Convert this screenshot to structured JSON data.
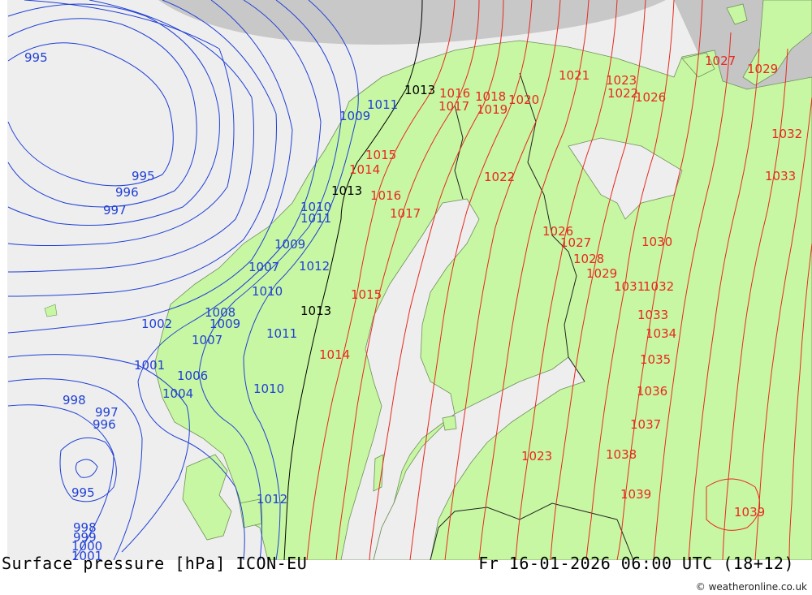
{
  "footer": {
    "left": "Surface pressure [hPa] ICON-EU",
    "right": "Fr 16-01-2026 06:00 UTC (18+12)",
    "credit": "© weatheronline.co.uk"
  },
  "colors": {
    "sea": "#eeeeee",
    "land": "#c8f7a3",
    "low_isobar": "#1f3fd6",
    "mid_isobar": "#000000",
    "high_isobar": "#e8281e",
    "no_data": "#c8c8c8"
  },
  "isobar_labels": [
    {
      "text": "995",
      "color": "blue"
    },
    {
      "text": "995",
      "color": "blue"
    },
    {
      "text": "996",
      "color": "blue"
    },
    {
      "text": "997",
      "color": "blue"
    },
    {
      "text": "998",
      "color": "blue"
    },
    {
      "text": "997",
      "color": "blue"
    },
    {
      "text": "996",
      "color": "blue"
    },
    {
      "text": "995",
      "color": "blue"
    },
    {
      "text": "998",
      "color": "blue"
    },
    {
      "text": "999",
      "color": "blue"
    },
    {
      "text": "1000",
      "color": "blue"
    },
    {
      "text": "1001",
      "color": "blue"
    },
    {
      "text": "1001",
      "color": "blue"
    },
    {
      "text": "1002",
      "color": "blue"
    },
    {
      "text": "1004",
      "color": "blue"
    },
    {
      "text": "1006",
      "color": "blue"
    },
    {
      "text": "1007",
      "color": "blue"
    },
    {
      "text": "1008",
      "color": "blue"
    },
    {
      "text": "1009",
      "color": "blue"
    },
    {
      "text": "1009",
      "color": "blue"
    },
    {
      "text": "1009",
      "color": "blue"
    },
    {
      "text": "1007",
      "color": "blue"
    },
    {
      "text": "1010",
      "color": "blue"
    },
    {
      "text": "1010",
      "color": "blue"
    },
    {
      "text": "1010",
      "color": "blue"
    },
    {
      "text": "1011",
      "color": "blue"
    },
    {
      "text": "1011",
      "color": "blue"
    },
    {
      "text": "1011",
      "color": "blue"
    },
    {
      "text": "1012",
      "color": "blue"
    },
    {
      "text": "1012",
      "color": "blue"
    },
    {
      "text": "1013",
      "color": "black"
    },
    {
      "text": "1013",
      "color": "black"
    },
    {
      "text": "1013",
      "color": "black"
    },
    {
      "text": "1014",
      "color": "red"
    },
    {
      "text": "1014",
      "color": "red"
    },
    {
      "text": "1015",
      "color": "red"
    },
    {
      "text": "1015",
      "color": "red"
    },
    {
      "text": "1016",
      "color": "red"
    },
    {
      "text": "1016",
      "color": "red"
    },
    {
      "text": "1017",
      "color": "red"
    },
    {
      "text": "1017",
      "color": "red"
    },
    {
      "text": "1018",
      "color": "red"
    },
    {
      "text": "1019",
      "color": "red"
    },
    {
      "text": "1020",
      "color": "red"
    },
    {
      "text": "1022",
      "color": "red"
    },
    {
      "text": "1023",
      "color": "red"
    },
    {
      "text": "1022",
      "color": "red"
    },
    {
      "text": "1021",
      "color": "red"
    },
    {
      "text": "1026",
      "color": "red"
    },
    {
      "text": "1027",
      "color": "red"
    },
    {
      "text": "1029",
      "color": "red"
    },
    {
      "text": "1026",
      "color": "red"
    },
    {
      "text": "1027",
      "color": "red"
    },
    {
      "text": "1028",
      "color": "red"
    },
    {
      "text": "1029",
      "color": "red"
    },
    {
      "text": "1030",
      "color": "red"
    },
    {
      "text": "1031",
      "color": "red"
    },
    {
      "text": "1032",
      "color": "red"
    },
    {
      "text": "1032",
      "color": "red"
    },
    {
      "text": "1033",
      "color": "red"
    },
    {
      "text": "1033",
      "color": "red"
    },
    {
      "text": "1034",
      "color": "red"
    },
    {
      "text": "1035",
      "color": "red"
    },
    {
      "text": "1036",
      "color": "red"
    },
    {
      "text": "1037",
      "color": "red"
    },
    {
      "text": "1038",
      "color": "red"
    },
    {
      "text": "1039",
      "color": "red"
    },
    {
      "text": "1039",
      "color": "red"
    },
    {
      "text": "1023",
      "color": "red"
    }
  ]
}
